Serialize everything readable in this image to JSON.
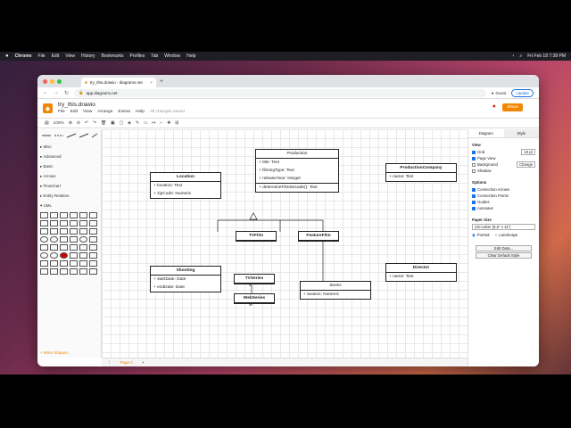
{
  "menubar": {
    "apple": "",
    "app": "Chrome",
    "items": [
      "File",
      "Edit",
      "View",
      "History",
      "Bookmarks",
      "Profiles",
      "Tab",
      "Window",
      "Help"
    ],
    "datetime": "Fri Feb 18  7:38 PM"
  },
  "browser": {
    "tab_title": "try_this.drawio - diagrams.net",
    "url": "app.diagrams.net",
    "guest": "Guest",
    "update": "Update"
  },
  "app": {
    "file_title": "try_this.drawio",
    "menus": [
      "File",
      "Edit",
      "View",
      "Arrange",
      "Extras",
      "Help"
    ],
    "saved": "All changes saved",
    "share": "Share",
    "zoom": "100%"
  },
  "sidebar": {
    "categories": [
      "Misc",
      "Advanced",
      "Basic",
      "Arrows",
      "Flowchart",
      "Entity Relation",
      "UML"
    ],
    "more_shapes": "+ More Shapes..."
  },
  "diagram": {
    "production": {
      "name": "Production",
      "attrs": [
        "+ title: Text",
        "+ filmingType: Text",
        "+ releaseYear: Integer"
      ],
      "method": "+ determineFilmDecade(): Text"
    },
    "location": {
      "name": "Location",
      "attrs": [
        "+ location: Text",
        "+ zipCode: Numeric"
      ]
    },
    "productionCompany": {
      "name": "ProductionCompany",
      "attrs": [
        "+ name: Text"
      ]
    },
    "tvfilm": {
      "name": "TVFilm"
    },
    "featurefilm": {
      "name": "FeatureFilm"
    },
    "shooting": {
      "name": "Shooting",
      "attrs": [
        "+ startDate: Date",
        "+ endDate: Date"
      ]
    },
    "tvseries": {
      "name": "TVSeries"
    },
    "webseries": {
      "name": "WebSeries"
    },
    "series": {
      "name": "Series",
      "attrs": [
        "+ season: Numeric"
      ]
    },
    "director": {
      "name": "Director",
      "attrs": [
        "+ name: Text"
      ]
    }
  },
  "panel": {
    "tabs": [
      "Diagram",
      "Style"
    ],
    "view_title": "View",
    "view_opts": [
      {
        "label": "Grid",
        "on": true,
        "extra": "10 pt"
      },
      {
        "label": "Page View",
        "on": true
      },
      {
        "label": "Background",
        "on": false,
        "extra": "Change"
      },
      {
        "label": "Shadow",
        "on": false
      }
    ],
    "options_title": "Options",
    "options": [
      "Connection Arrows",
      "Connection Points",
      "Guides",
      "Autosave"
    ],
    "paper_title": "Paper Size",
    "paper_value": "US-Letter (8,5\" x 11\")",
    "orientation": [
      "Portrait",
      "Landscape"
    ],
    "edit_data": "Edit Data...",
    "clear_style": "Clear Default Style"
  },
  "pages": {
    "tab": "Page-1"
  }
}
